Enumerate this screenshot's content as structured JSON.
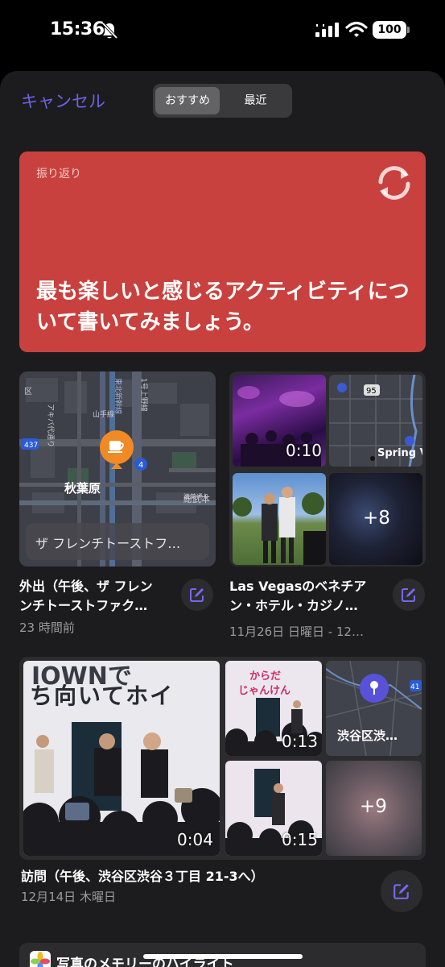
{
  "status": {
    "time": "15:36",
    "battery": "100"
  },
  "header": {
    "cancel": "キャンセル",
    "segments": [
      "おすすめ",
      "最近"
    ]
  },
  "prompt": {
    "label": "振り返り",
    "text": "最も楽しいと感じるアクティビティについて書いてみましょう。",
    "color": "#c9413e"
  },
  "memories": [
    {
      "map": {
        "area_label": "秋葉原",
        "place_banner": "ザ フレンチトーストフ…",
        "street_labels": [
          "秋葉原",
          "清美通り",
          "総武本",
          "1号上野線",
          "山手線",
          "東北新幹線",
          "437",
          "4"
        ]
      },
      "title_line1": "外出（午後、ザ フレン",
      "title_line2": "ンチトーストファク…",
      "subtitle": "23 時間前"
    },
    {
      "tiles": {
        "video_duration": "0:10",
        "map_labels": [
          "95",
          "Spring V"
        ],
        "more_count": "+8"
      },
      "title_line1": "Las Vegasのベネチア",
      "title_line2": "ン・ホテル・カジノ…",
      "subtitle": "11月26日 日曜日 - 12…"
    },
    {
      "tiles": {
        "screen_text_top": "IOWNで",
        "screen_text_main": "ち向いてホイ",
        "small_screen_text": [
          "からだ",
          "じゃんけん"
        ],
        "durations": [
          "0:04",
          "0:13",
          "0:15"
        ],
        "map_label": "渋谷区渋…",
        "map_route": "41",
        "more_count": "+9"
      },
      "title": "訪問（午後、渋谷区渋谷３丁目 21-3へ）",
      "subtitle": "12月14日 木曜日"
    }
  ],
  "highlights": {
    "text": "写真のメモリーのハイライト"
  },
  "colors": {
    "accent": "#6e62e8",
    "card": "#2c2c2e",
    "sheet": "#1c1c1e"
  }
}
